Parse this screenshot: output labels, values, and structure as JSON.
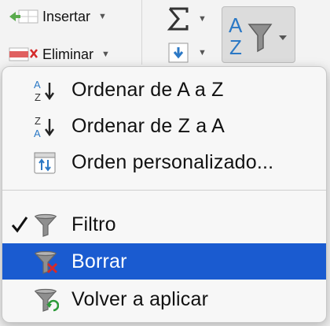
{
  "ribbon": {
    "insert_label": "Insertar",
    "delete_label": "Eliminar",
    "sort_filter_icon": "sort-az-funnel-icon",
    "autosum_icon": "sigma-icon",
    "fill_icon": "fill-down-icon"
  },
  "menu": {
    "items": [
      {
        "label": "Ordenar de A a Z",
        "icon": "sort-az-icon"
      },
      {
        "label": "Ordenar de Z a A",
        "icon": "sort-za-icon"
      },
      {
        "label": "Orden personalizado...",
        "icon": "custom-sort-icon"
      },
      {
        "label": "Filtro",
        "icon": "funnel-icon",
        "checked": true
      },
      {
        "label": "Borrar",
        "icon": "clear-filter-icon",
        "highlighted": true
      },
      {
        "label": "Volver a aplicar",
        "icon": "reapply-filter-icon"
      }
    ]
  },
  "colors": {
    "highlight": "#1a5bd0",
    "sort_blue": "#2b78c5",
    "delete_red": "#d42a2a",
    "reapply_green": "#2e9b3a"
  }
}
